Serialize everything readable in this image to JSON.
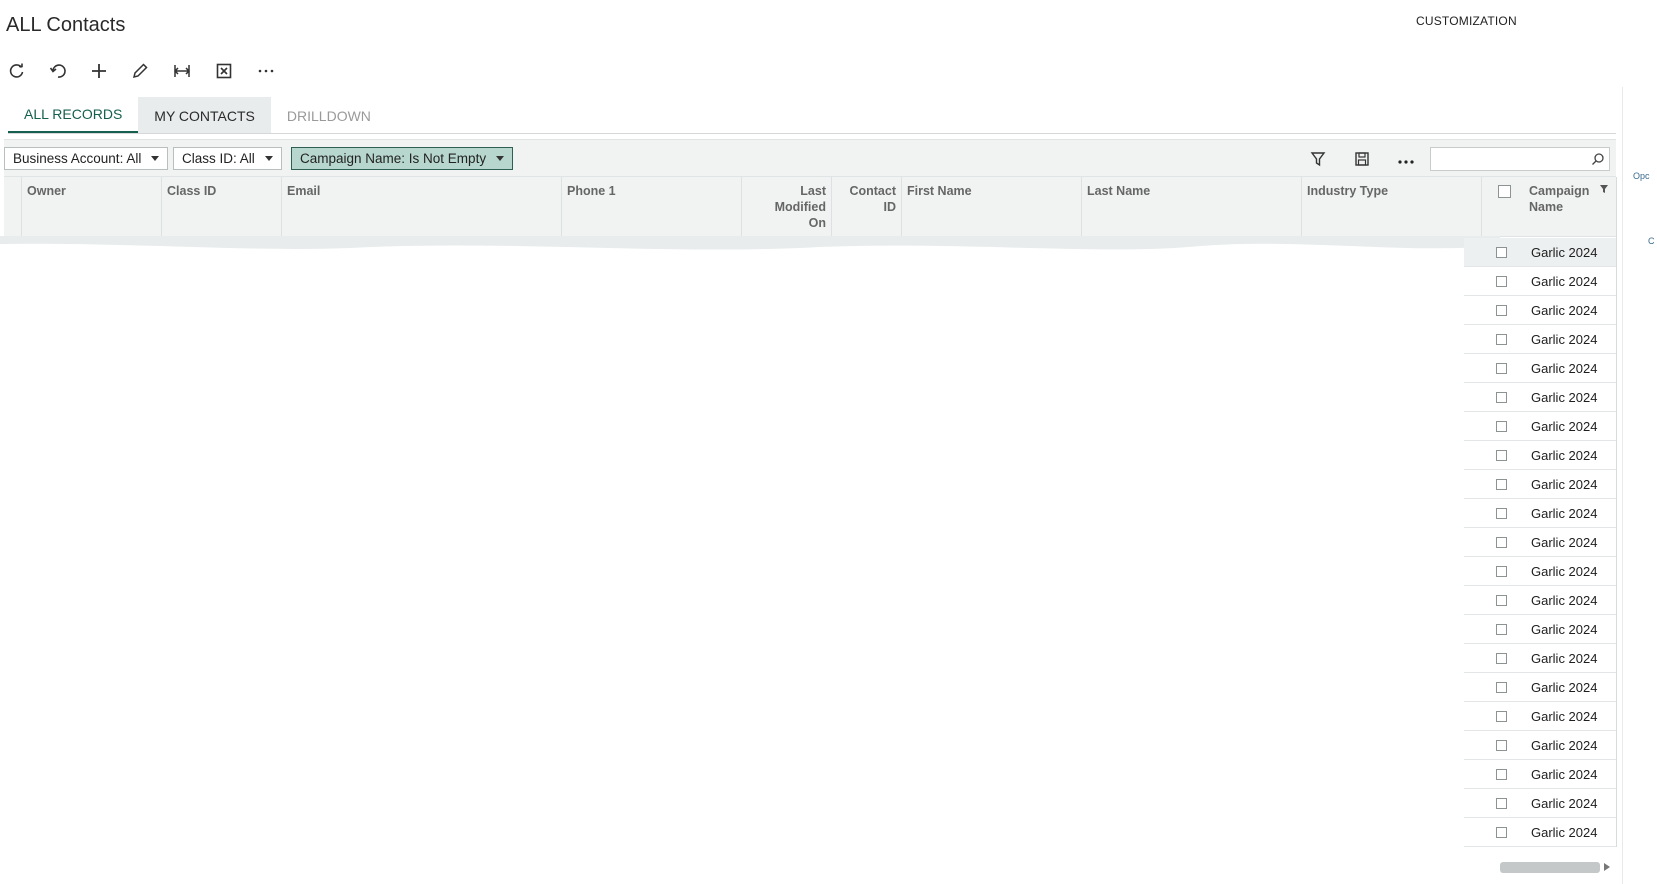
{
  "header": {
    "title": "ALL Contacts",
    "customization_label": "CUSTOMIZATION"
  },
  "toolbar": {
    "icons": [
      "refresh-icon",
      "undo-icon",
      "add-icon",
      "edit-icon",
      "fit-to-screen-icon",
      "export-excel-icon",
      "more-icon"
    ]
  },
  "tabs": [
    {
      "label": "ALL RECORDS",
      "state": "active"
    },
    {
      "label": "MY CONTACTS",
      "state": "shaded"
    },
    {
      "label": "DRILLDOWN",
      "state": "muted"
    }
  ],
  "filters": [
    {
      "label": "Business Account: All"
    },
    {
      "label": "Class ID: All"
    },
    {
      "label": "Campaign Name: Is Not Empty",
      "highlighted": true
    }
  ],
  "grid": {
    "columns": {
      "owner": "Owner",
      "class_id": "Class ID",
      "email": "Email",
      "phone1": "Phone 1",
      "last_modified_1": "Last",
      "last_modified_2": "Modified",
      "last_modified_3": "On",
      "contact_id_1": "Contact",
      "contact_id_2": "ID",
      "first_name": "First Name",
      "last_name": "Last Name",
      "industry_type": "Industry Type",
      "campaign_name_1": "Campaign",
      "campaign_name_2": "Name"
    },
    "rows": [
      "Garlic 2024",
      "Garlic 2024",
      "Garlic 2024",
      "Garlic 2024",
      "Garlic 2024",
      "Garlic 2024",
      "Garlic 2024",
      "Garlic 2024",
      "Garlic 2024",
      "Garlic 2024",
      "Garlic 2024",
      "Garlic 2024",
      "Garlic 2024",
      "Garlic 2024",
      "Garlic 2024",
      "Garlic 2024",
      "Garlic 2024",
      "Garlic 2024",
      "Garlic 2024",
      "Garlic 2024",
      "Garlic 2024"
    ]
  },
  "side_panel": {
    "text_1": "Opc",
    "text_2": "C"
  },
  "colors": {
    "accent": "#155f4e",
    "filter_highlight": "#b7d7ce",
    "header_bg": "#f1f3f3"
  }
}
